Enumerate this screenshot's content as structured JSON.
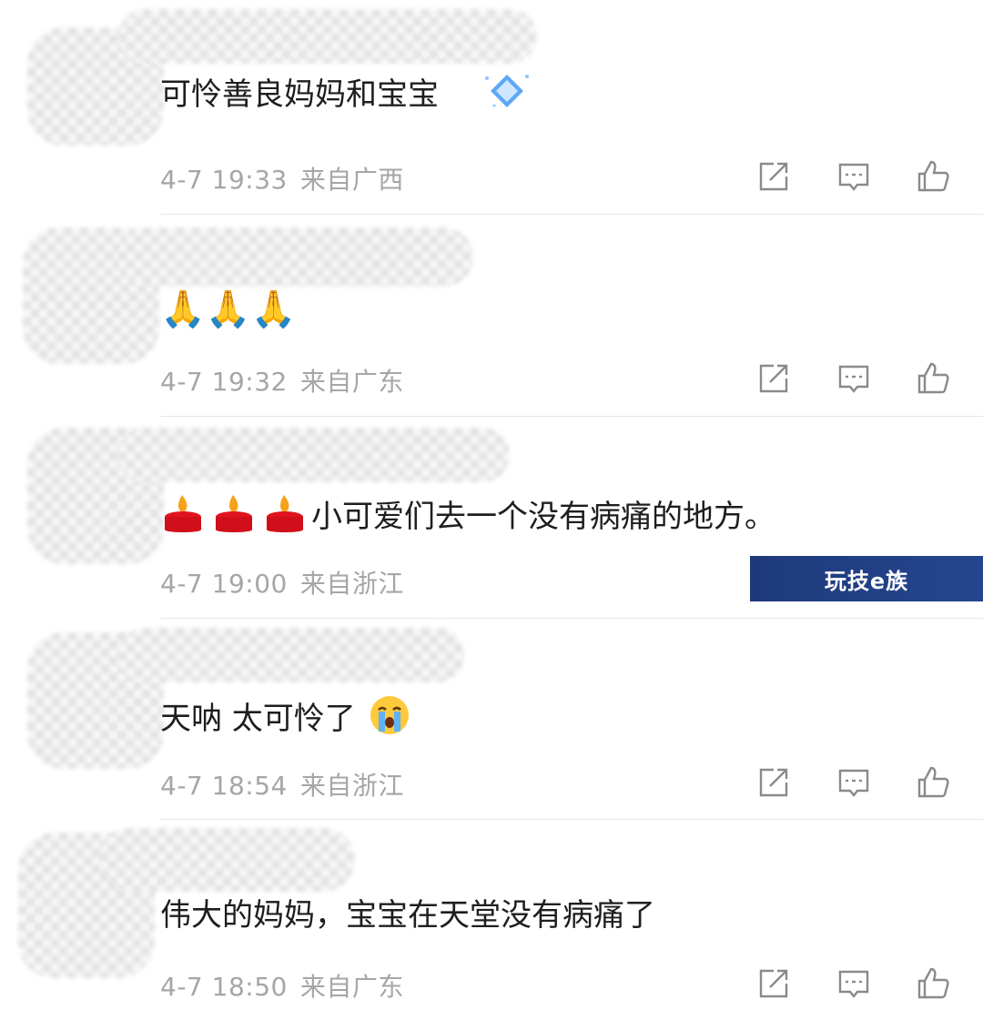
{
  "comments": [
    {
      "text": "可怜善良妈妈和宝宝",
      "time": "4-7 19:33",
      "location": "来自广西"
    },
    {
      "text": "🙏🙏🙏",
      "time": "4-7 19:32",
      "location": "来自广东"
    },
    {
      "text": "小可爱们去一个没有病痛的地方。",
      "time": "4-7 19:00",
      "location": "来自浙江"
    },
    {
      "text": "天呐 太可怜了",
      "time": "4-7 18:54",
      "location": "来自浙江"
    },
    {
      "text": "伟大的妈妈，宝宝在天堂没有病痛了",
      "time": "4-7 18:50",
      "location": "来自广东"
    }
  ],
  "watermark": {
    "text": "玩技e族",
    "color": "#1e3a7b"
  },
  "icons": [
    "share-icon",
    "comment-icon",
    "like-icon",
    "diamond-badge-icon",
    "candle-emoji-icon",
    "crying-emoji-icon"
  ]
}
